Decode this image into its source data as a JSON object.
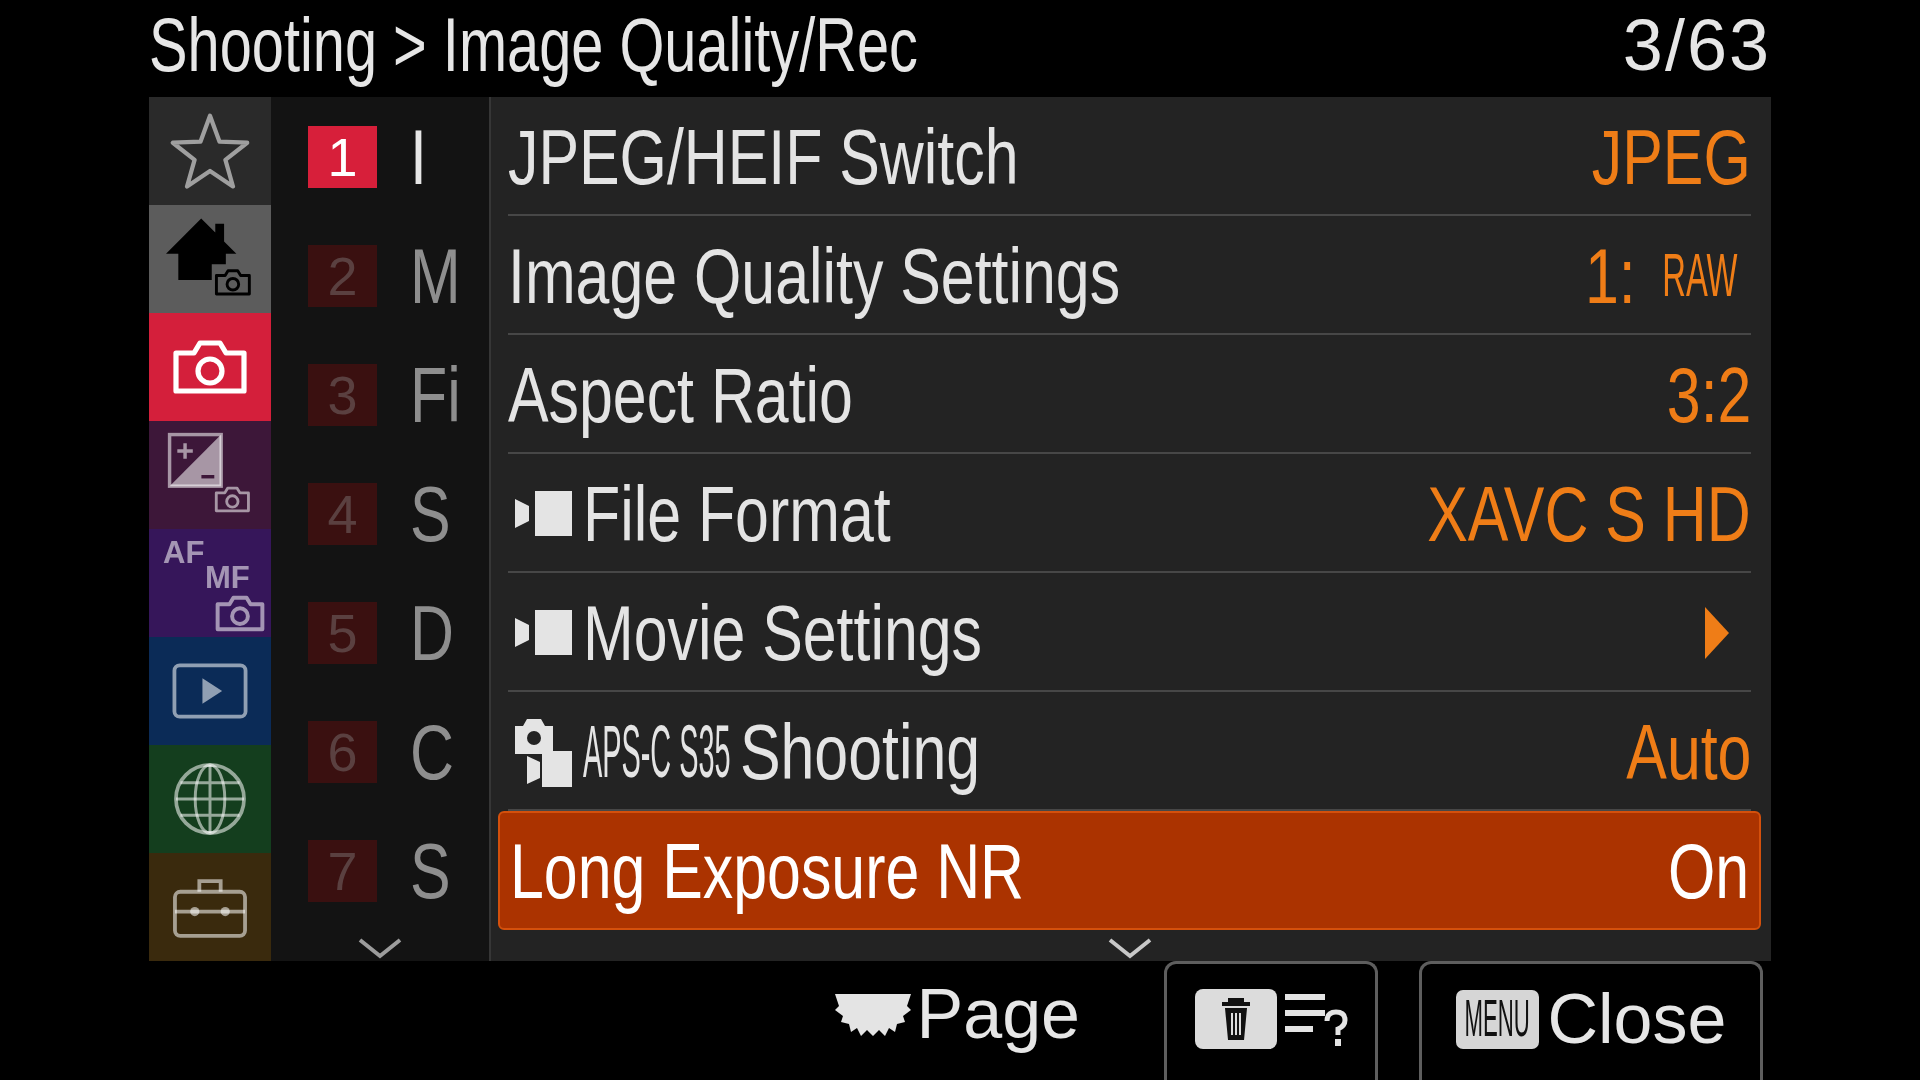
{
  "header": {
    "title": "Shooting > Image Quality/Rec",
    "page_count": "3/63"
  },
  "categories": [
    {
      "kind": "favorites",
      "color": "#2a2a2a",
      "selected": false
    },
    {
      "kind": "main",
      "color": "#5c5c5c",
      "selected": false
    },
    {
      "kind": "shooting",
      "color": "#d41f3b",
      "selected": true
    },
    {
      "kind": "exposure",
      "color": "#3d1739",
      "selected": false
    },
    {
      "kind": "focus",
      "color": "#36165a",
      "selected": false,
      "labels": [
        "AF",
        "MF"
      ]
    },
    {
      "kind": "playback",
      "color": "#0b2b57",
      "selected": false
    },
    {
      "kind": "network",
      "color": "#143e1e",
      "selected": false
    },
    {
      "kind": "setup",
      "color": "#3a2a0d",
      "selected": false
    }
  ],
  "pages": {
    "items": [
      {
        "number": "1",
        "title": "I",
        "selected": true
      },
      {
        "number": "2",
        "title": "M",
        "selected": false
      },
      {
        "number": "3",
        "title": "Fi",
        "selected": false
      },
      {
        "number": "4",
        "title": "S",
        "selected": false
      },
      {
        "number": "5",
        "title": "D",
        "selected": false
      },
      {
        "number": "6",
        "title": "C",
        "selected": false
      },
      {
        "number": "7",
        "title": "S",
        "selected": false
      }
    ],
    "more_below": true
  },
  "settings": {
    "rows": [
      {
        "kind": "general",
        "label": "JPEG/HEIF Switch",
        "value": "JPEG",
        "submenu": false,
        "selected": false
      },
      {
        "kind": "general",
        "label": "Image Quality Settings",
        "value": "1:",
        "value_note": "RAW",
        "submenu": false,
        "selected": false
      },
      {
        "kind": "general",
        "label": "Aspect Ratio",
        "value": "3:2",
        "submenu": false,
        "selected": false
      },
      {
        "kind": "movie",
        "label": "File Format",
        "value": "XAVC S HD",
        "submenu": false,
        "selected": false
      },
      {
        "kind": "movie",
        "label": "Movie Settings",
        "submenu": true,
        "selected": false
      },
      {
        "kind": "hybrid",
        "prefix": "APS-C S35",
        "label": "Shooting",
        "value": "Auto",
        "submenu": false,
        "selected": false
      },
      {
        "kind": "general",
        "label": "Long Exposure NR",
        "value": "On",
        "submenu": false,
        "selected": true
      }
    ],
    "more_below": true
  },
  "footer": {
    "page_hint": "Page",
    "close_key": "MENU",
    "close_label": "Close"
  }
}
